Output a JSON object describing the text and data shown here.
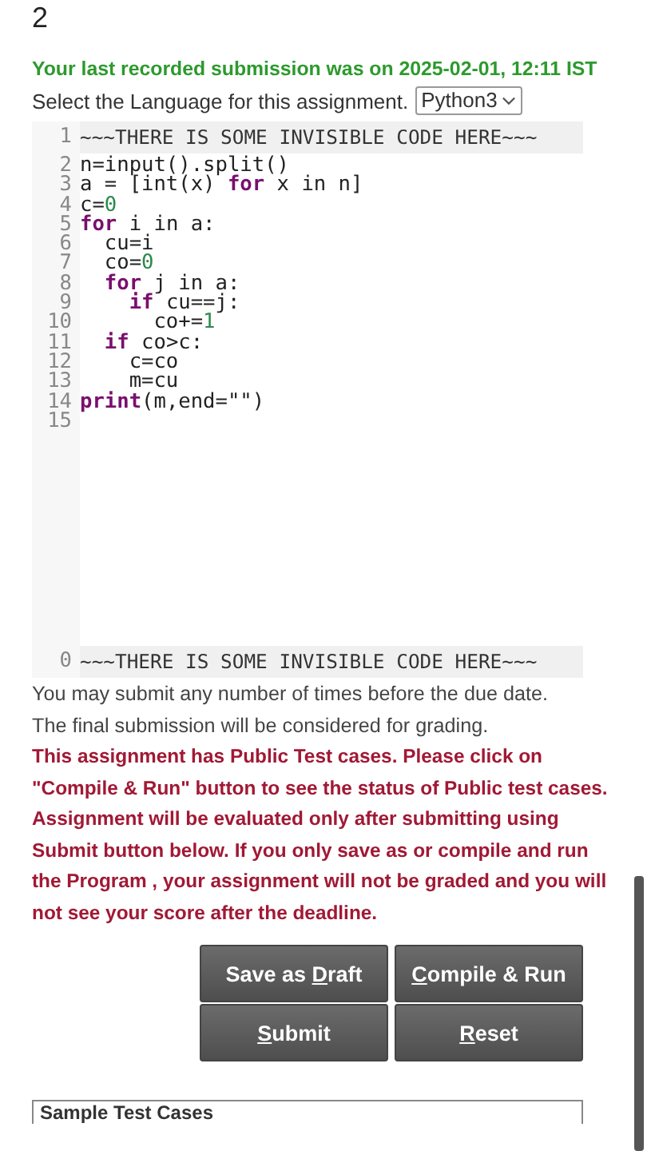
{
  "question_number": "2",
  "last_submission": "Your last recorded submission was on 2025-02-01, 12:11 IST",
  "language": {
    "label": "Select the Language for this assignment.",
    "value": "Python3"
  },
  "editor": {
    "header": {
      "number": "1",
      "text": "~~~THERE IS SOME INVISIBLE CODE HERE~~~"
    },
    "lines": [
      {
        "number": "2",
        "tokens": [
          {
            "kind": "plain",
            "text": "n=input().split()"
          }
        ]
      },
      {
        "number": "3",
        "tokens": [
          {
            "kind": "plain",
            "text": "a = [int(x) "
          },
          {
            "kind": "keyword",
            "text": "for"
          },
          {
            "kind": "plain",
            "text": " x in n]"
          }
        ]
      },
      {
        "number": "4",
        "tokens": [
          {
            "kind": "plain",
            "text": "c="
          },
          {
            "kind": "number",
            "text": "0"
          }
        ]
      },
      {
        "number": "5",
        "tokens": [
          {
            "kind": "keyword",
            "text": "for"
          },
          {
            "kind": "plain",
            "text": " i in a:"
          }
        ]
      },
      {
        "number": "6",
        "tokens": [
          {
            "kind": "plain",
            "text": "  cu=i"
          }
        ]
      },
      {
        "number": "7",
        "tokens": [
          {
            "kind": "plain",
            "text": "  co="
          },
          {
            "kind": "number",
            "text": "0"
          }
        ]
      },
      {
        "number": "8",
        "tokens": [
          {
            "kind": "keyword",
            "text": "  for"
          },
          {
            "kind": "plain",
            "text": " j in a:"
          }
        ]
      },
      {
        "number": "9",
        "tokens": [
          {
            "kind": "keyword",
            "text": "    if"
          },
          {
            "kind": "plain",
            "text": " cu==j:"
          }
        ]
      },
      {
        "number": "10",
        "tokens": [
          {
            "kind": "plain",
            "text": "      co+="
          },
          {
            "kind": "number",
            "text": "1"
          }
        ]
      },
      {
        "number": "11",
        "tokens": [
          {
            "kind": "keyword",
            "text": "  if"
          },
          {
            "kind": "plain",
            "text": " co>c:"
          }
        ]
      },
      {
        "number": "12",
        "tokens": [
          {
            "kind": "plain",
            "text": "    c=co"
          }
        ]
      },
      {
        "number": "13",
        "tokens": [
          {
            "kind": "plain",
            "text": "    m=cu"
          }
        ]
      },
      {
        "number": "14",
        "tokens": [
          {
            "kind": "keyword",
            "text": "print"
          },
          {
            "kind": "plain",
            "text": "(m,end=\"\")"
          }
        ]
      },
      {
        "number": "15"
      }
    ],
    "footer": {
      "number": "0",
      "text": "~~~THERE IS SOME INVISIBLE CODE HERE~~~"
    }
  },
  "info": [
    "You may submit any number of times before the due date.",
    "The final submission will be considered for grading."
  ],
  "warning": "This assignment has Public Test cases. Please click on \"Compile & Run\" button to see the status of Public test cases. Assignment will be evaluated only after submitting using Submit button below. If you only save as or compile and run the Program , your assignment will not be graded and you will not see your score after the deadline.",
  "buttons": [
    {
      "before": "Save as ",
      "key": "D",
      "after": "raft"
    },
    {
      "key": "C",
      "after": "ompile & Run"
    },
    {
      "key": "S",
      "after": "ubmit"
    },
    {
      "key": "R",
      "after": "eset"
    }
  ],
  "sample_heading": "Sample Test Cases"
}
